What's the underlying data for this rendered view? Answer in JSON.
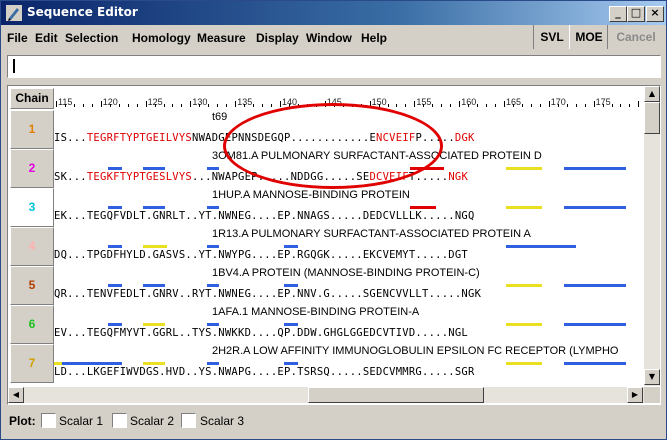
{
  "window": {
    "title": "Sequence Editor"
  },
  "menu": [
    "File",
    "Edit",
    "Selection",
    "Homology",
    "Measure",
    "Display",
    "Window",
    "Help"
  ],
  "toolbar_right": [
    "SVL",
    "MOE",
    "Cancel"
  ],
  "command_line": {
    "value": ""
  },
  "chain_header": "Chain",
  "ruler_ticks": [
    "115",
    "120",
    "125",
    "130",
    "135",
    "140",
    "145",
    "150",
    "155",
    "160",
    "165",
    "170",
    "175"
  ],
  "chains": [
    {
      "num": "1",
      "color": "#e08000",
      "title": "t69",
      "seq": [
        [
          "IS...",
          ""
        ],
        [
          "TEGRFTYPTGEILVYS",
          "red"
        ],
        [
          "NWADGEPNNSDEGQP............E",
          ""
        ],
        [
          "NCVEIF",
          "red"
        ],
        [
          "P.....",
          ""
        ],
        [
          "DGK",
          "red"
        ]
      ]
    },
    {
      "num": "2",
      "color": "#e000e0",
      "title": "3OM81.A PULMONARY SURFACTANT-ASSOCIATED PROTEIN D",
      "seq": [
        [
          "SK...",
          ""
        ],
        [
          "TEGKFTYPTGESLVYS",
          "red"
        ],
        [
          "...NWAPGEP.....NDDGG.....SE",
          ""
        ],
        [
          "DCVEIF",
          "red"
        ],
        [
          "T.....",
          ""
        ],
        [
          "NGK",
          "red"
        ]
      ]
    },
    {
      "num": "3",
      "color": "#00c0e0",
      "title": "1HUP.A MANNOSE-BINDING PROTEIN",
      "seq": [
        [
          "EK...TEGQFVDLT.GNRLT..YT.NWNEG....EP.NNAGS.....DEDCVLLLK.....NGQ",
          ""
        ]
      ]
    },
    {
      "num": "4",
      "color": "#ffb0b0",
      "title": "1R13.A PULMONARY SURFACTANT-ASSOCIATED PROTEIN A",
      "seq": [
        [
          "DQ...TPGDFHYLD.GASVS..YT.NWYPG....EP.RGQGK.....EKCVEMYT.....DGT",
          ""
        ]
      ]
    },
    {
      "num": "5",
      "color": "#b04000",
      "title": "1BV4.A PROTEIN (MANNOSE-BINDING PROTEIN-C)",
      "seq": [
        [
          "QR...TENVFEDLT.GNRV..RYT.NWNEG....EP.NNV.G.....SGENCVVLLT.....NGK",
          ""
        ]
      ]
    },
    {
      "num": "6",
      "color": "#20c020",
      "title": "1AFA.1 MANNOSE-BINDING PROTEIN-A",
      "seq": [
        [
          "EV...TEGQFMYVT.GGRL..TYS.NWKKD....QP.DDW.GHGLGGEDCVTIVD.....NGL",
          ""
        ]
      ]
    },
    {
      "num": "7",
      "color": "#d0a000",
      "title": "2H2R.A LOW AFFINITY IMMUNOGLOBULIN EPSILON FC RECEPTOR (LYMPHO",
      "seq": [
        [
          "LD...LKGEFIWVDGS.HVD..YS.NWAPG....EP.TSRSQ.....SEDCVMMRG.....SGR",
          ""
        ]
      ]
    }
  ],
  "plot": {
    "label": "Plot:",
    "options": [
      "Scalar 1",
      "Scalar 2",
      "Scalar 3"
    ]
  },
  "colors": {
    "blue_bar": "#3060e0",
    "yellow_bar": "#e8e020",
    "red_bar": "#e00000",
    "annotation": "#e00000"
  }
}
